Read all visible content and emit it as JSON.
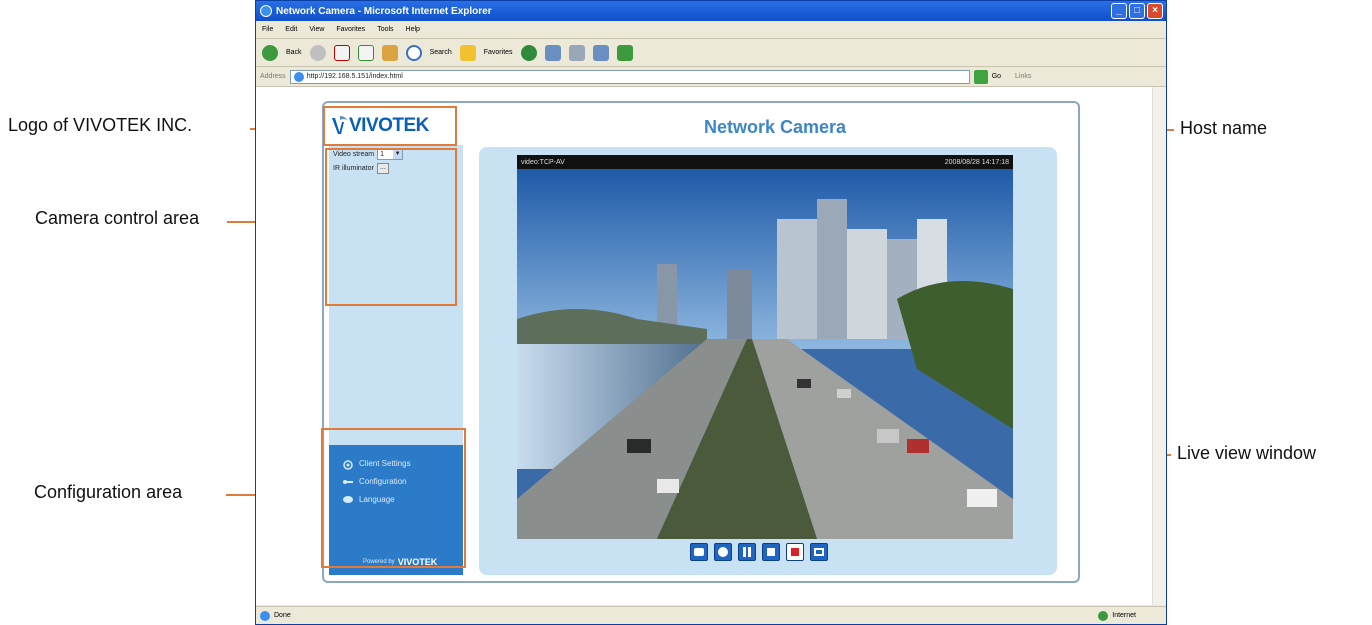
{
  "browser": {
    "title": "Network Camera - Microsoft Internet Explorer",
    "menu": [
      "File",
      "Edit",
      "View",
      "Favorites",
      "Tools",
      "Help"
    ],
    "toolbar": {
      "back_label": "Back",
      "search_label": "Search",
      "favorites_label": "Favorites"
    },
    "address_label": "Address",
    "address_value": "http://192.168.5.151/index.html",
    "go_label": "Go",
    "links_label": "Links",
    "status_left": "Done",
    "status_right": "Internet"
  },
  "page": {
    "logo_text": "VIVOTEK",
    "host_name": "Network Camera",
    "camera_control": {
      "video_stream_label": "Video stream",
      "video_stream_value": "1",
      "ir_label": "IR illuminator",
      "ir_button": "..."
    },
    "config": {
      "items": [
        {
          "label": "Client Settings",
          "icon": "client-settings-icon"
        },
        {
          "label": "Configuration",
          "icon": "configuration-icon"
        },
        {
          "label": "Language",
          "icon": "language-icon"
        }
      ],
      "powered_by": "Powered by",
      "powered_brand": "VIVOTEK"
    },
    "live_view": {
      "stream_info": "video:TCP-AV",
      "timestamp": "2008/08/28 14:17:18",
      "controls": [
        "snapshot-icon",
        "digital-zoom-icon",
        "pause-icon",
        "stop-icon",
        "record-icon",
        "fullscreen-icon"
      ]
    }
  },
  "callouts": {
    "logo": "Logo of VIVOTEK INC.",
    "host_name": "Host name",
    "camera_control": "Camera control area",
    "live_view": "Live view window",
    "config": "Configuration area"
  },
  "colors": {
    "callout_line": "#e07b3a",
    "panel_light": "#c8e2f4",
    "config_blue": "#2c7bc8",
    "host_name": "#3d86c7",
    "logo_blue": "#0a5fb8"
  }
}
